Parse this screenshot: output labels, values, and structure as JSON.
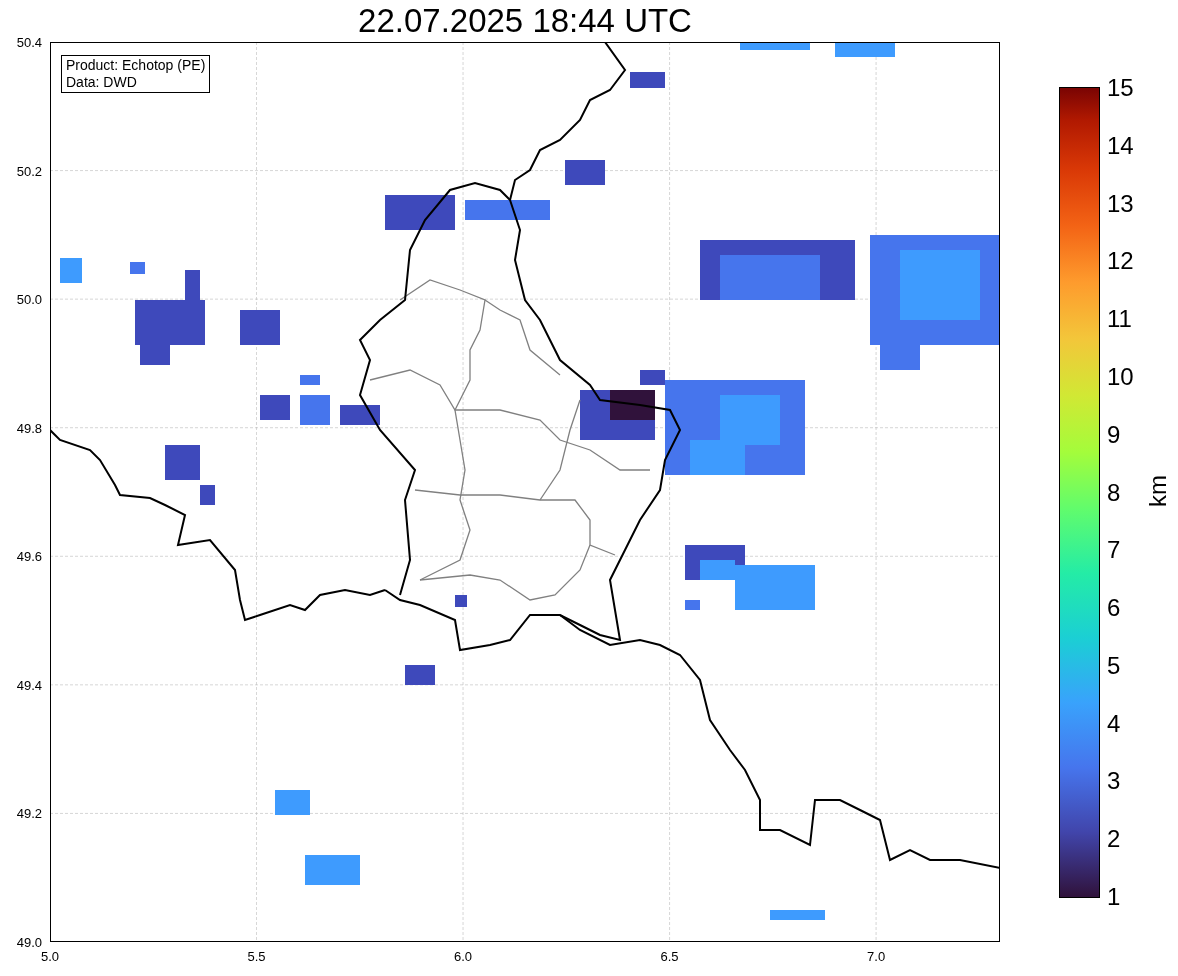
{
  "title": "22.07.2025 18:44 UTC",
  "legend": [
    "Product: Echotop (PE)",
    "Data: DWD"
  ],
  "x_ticks": [
    "5.0",
    "5.5",
    "6.0",
    "6.5",
    "7.0"
  ],
  "y_ticks": [
    "50.4",
    "50.2",
    "50.0",
    "49.8",
    "49.6",
    "49.4",
    "49.2",
    "49.0"
  ],
  "colorbar": {
    "label": "km",
    "ticks": [
      "15",
      "14",
      "13",
      "12",
      "11",
      "10",
      "9",
      "8",
      "7",
      "6",
      "5",
      "4",
      "3",
      "2",
      "1"
    ]
  }
}
